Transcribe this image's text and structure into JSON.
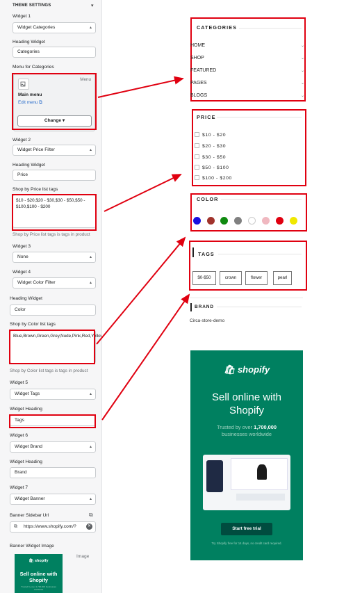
{
  "panel": {
    "title": "THEME SETTINGS",
    "widget1": {
      "label": "Widget 1",
      "value": "Widget Categories"
    },
    "heading1": {
      "label": "Heading Widget",
      "value": "Categories"
    },
    "menu": {
      "label": "Menu for Categories",
      "badge": "Menu",
      "name": "Main menu",
      "edit": "Edit menu",
      "change": "Change"
    },
    "widget2": {
      "label": "Widget 2",
      "value": "Widget Price Filter"
    },
    "heading2": {
      "label": "Heading Widget",
      "value": "Price"
    },
    "price_tags": {
      "label": "Shop by Price list tags",
      "value": "$10 - $20,$20 - $30,$30 - $50,$50 - $100,$100 - $200",
      "help": "Shop by Price list tags is tags in product"
    },
    "widget3": {
      "label": "Widget 3",
      "value": "None"
    },
    "widget4": {
      "label": "Widget 4",
      "value": "Widget Color Filter"
    },
    "heading4": {
      "label": "Heading Widget",
      "value": "Color"
    },
    "color_tags": {
      "label": "Shop by Color list tags",
      "value": "Blue,Brown,Green,Grey,Nude,Pink,Red,Yellow",
      "help": "Shop by Color list tags is tags in product"
    },
    "widget5": {
      "label": "Widget 5",
      "value": "Widget Tags"
    },
    "heading5": {
      "label": "Widget Heading",
      "value": "Tags"
    },
    "widget6": {
      "label": "Widget 6",
      "value": "Widget Brand"
    },
    "heading6": {
      "label": "Widget Heading",
      "value": "Brand"
    },
    "widget7": {
      "label": "Widget 7",
      "value": "Widget Banner"
    },
    "banner_url": {
      "label": "Banner Sidebar Url",
      "value": "https://www.shopify.com/?"
    },
    "banner_image": {
      "label": "Banner Widget Image",
      "badge": "Image"
    }
  },
  "preview": {
    "categories": {
      "title": "CATEGORIES",
      "items": [
        "HOME",
        "SHOP",
        "FEATURED",
        "PAGES",
        "BLOGS"
      ]
    },
    "price": {
      "title": "PRICE",
      "items": [
        "$10 - $20",
        "$20 - $30",
        "$30 - $50",
        "$50 - $100",
        "$100 - $200"
      ]
    },
    "color": {
      "title": "COLOR",
      "swatches": [
        "#1a10e0",
        "#a1332c",
        "#108a10",
        "#808080",
        "#ffffff",
        "#f0b8c0",
        "#e00010",
        "#f0e800"
      ]
    },
    "tags": {
      "title": "TAGS",
      "items": [
        "$0-$50",
        "crown",
        "flower",
        "pearl"
      ]
    },
    "brand": {
      "title": "BRAND",
      "item": "Circa-store-demo"
    },
    "banner": {
      "logo": "shopify",
      "headline": "Sell online with Shopify",
      "sub_prefix": "Trusted by over ",
      "sub_count": "1,700,000",
      "sub_suffix": "businesses worldwide",
      "cta": "Start free trial",
      "fine": "Try Shopify free for 14 days, no credit card required."
    },
    "mini_banner": {
      "logo": "shopify",
      "headline": "Sell online with Shopify",
      "sub": "Trusted by over 1,700,000 businesses worldwide"
    }
  },
  "colors": {
    "annotation": "#e00010",
    "shopify_green": "#008060"
  }
}
